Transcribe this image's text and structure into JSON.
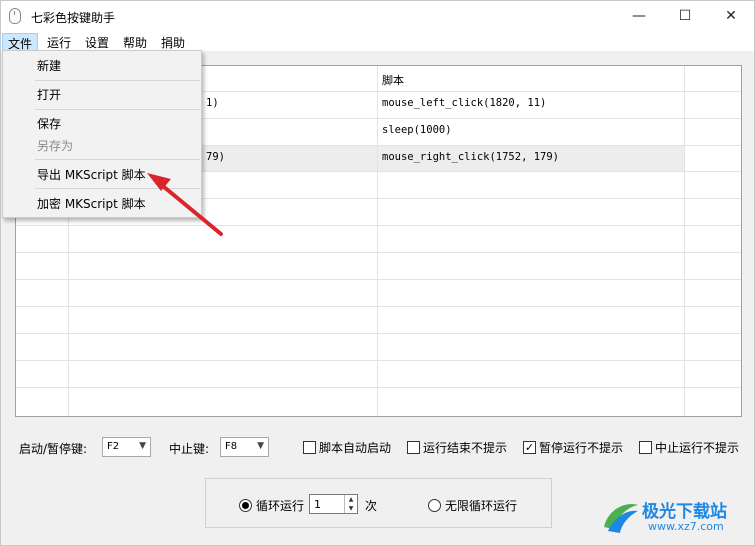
{
  "window": {
    "title": "七彩色按键助手",
    "controls": {
      "minimize": "—",
      "maximize": "☐",
      "close": "✕"
    }
  },
  "menubar": {
    "items": [
      "文件",
      "运行",
      "设置",
      "帮助",
      "捐助"
    ]
  },
  "file_menu": {
    "new": "新建",
    "open": "打开",
    "save": "保存",
    "save_as": "另存为",
    "export": "导出 MKScript 脚本",
    "encrypt": "加密 MKScript 脚本"
  },
  "table": {
    "header_script": "脚本",
    "rows": [
      {
        "partial": "1)",
        "script": "mouse_left_click(1820, 11)"
      },
      {
        "partial": "",
        "script": "sleep(1000)"
      },
      {
        "partial": "79)",
        "script": "mouse_right_click(1752, 179)"
      }
    ]
  },
  "controls": {
    "start_pause_label": "启动/暂停键:",
    "start_pause_value": "F2",
    "stop_label": "中止键:",
    "stop_value": "F8",
    "auto_start_label": "脚本自动启动",
    "auto_start_checked": false,
    "run_end_no_prompt_label": "运行结束不提示",
    "run_end_no_prompt_checked": false,
    "pause_no_prompt_label": "暂停运行不提示",
    "pause_no_prompt_checked": true,
    "stop_no_prompt_label": "中止运行不提示",
    "stop_no_prompt_checked": false
  },
  "loop": {
    "loop_label": "循环运行",
    "loop_selected": true,
    "count": "1",
    "times_label": "次",
    "infinite_label": "无限循环运行"
  },
  "watermark": {
    "brand": "极光下载站",
    "url": "www.xz7.com"
  },
  "colors": {
    "arrow": "#d9262a",
    "menu_highlight": "#cce8ff",
    "logo_green": "#4caf50",
    "logo_blue": "#1e88e5"
  }
}
